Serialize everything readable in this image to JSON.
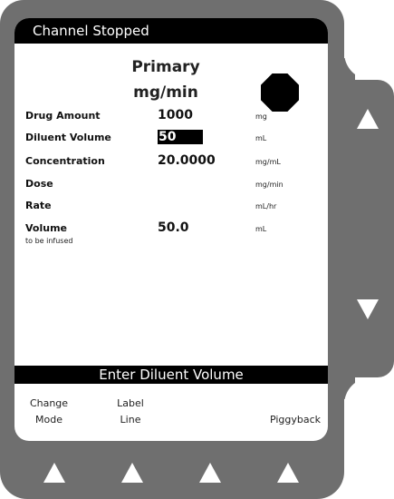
{
  "header": {
    "title": "Channel Stopped"
  },
  "mode": {
    "title": "Primary",
    "units": "mg/min"
  },
  "status_icon": "stop-octagon-icon",
  "rows": [
    {
      "label": "Drug Amount",
      "value": "1000",
      "unit": "mg"
    },
    {
      "label": "Diluent Volume",
      "value": "50",
      "unit": "mL"
    },
    {
      "label": "Concentration",
      "value": "20.0000",
      "unit": "mg/mL"
    },
    {
      "label": "Dose",
      "value": "",
      "unit": "mg/min"
    },
    {
      "label": "Rate",
      "value": "",
      "unit": "mL/hr"
    },
    {
      "label": "Volume",
      "sublabel": "to be infused",
      "value": "50.0",
      "unit": "mL"
    }
  ],
  "prompt": "Enter Diluent Volume",
  "softkeys": [
    {
      "line1": "Change",
      "line2": "Mode"
    },
    {
      "line1": "Label",
      "line2": "Line"
    },
    {
      "line1": "",
      "line2": ""
    },
    {
      "line1": "Piggyback"
    }
  ],
  "colors": {
    "bezel": "#6f6f6f",
    "screen": "#ffffff",
    "bar": "#000000"
  }
}
